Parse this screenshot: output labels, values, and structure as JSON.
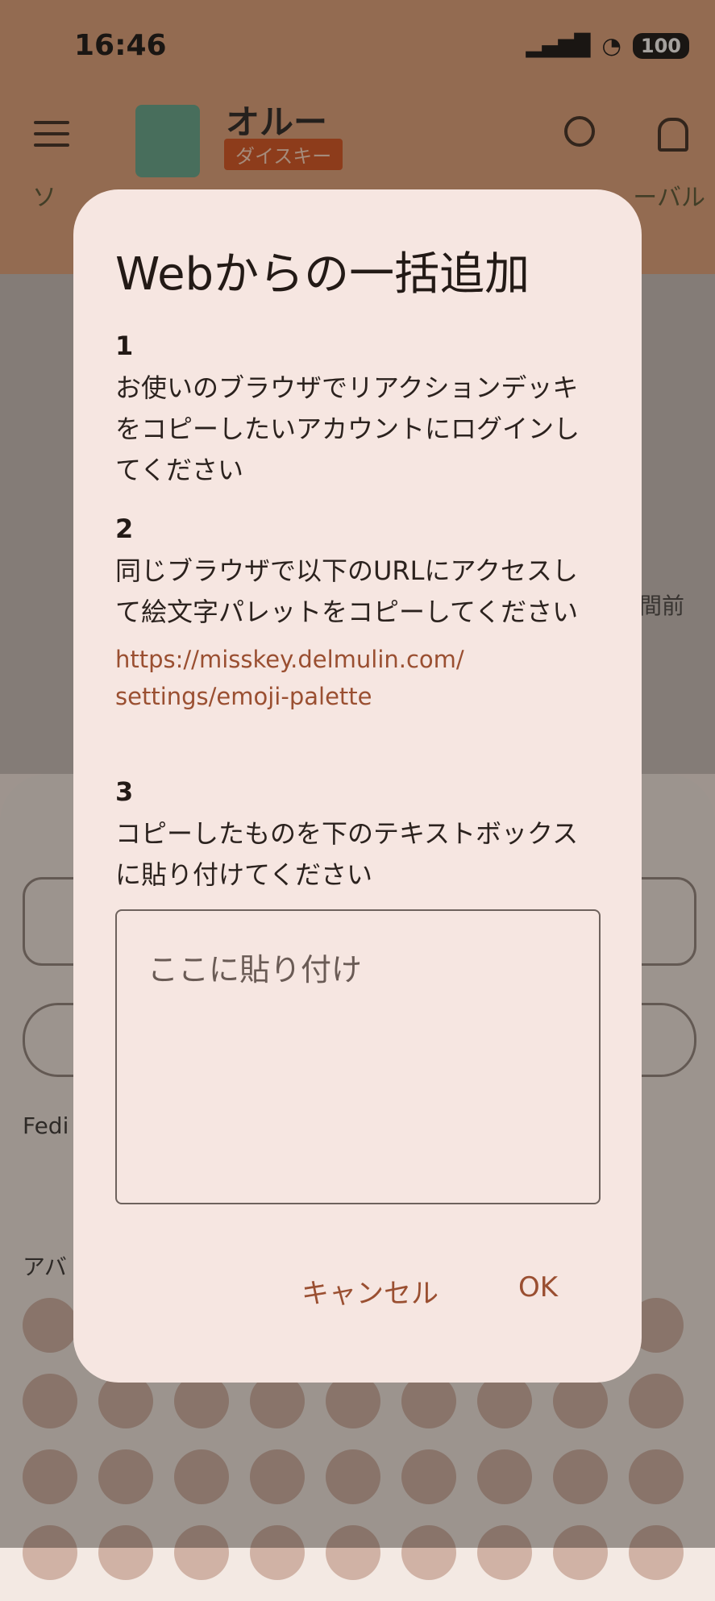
{
  "status_bar": {
    "time": "16:46",
    "battery": "100"
  },
  "header": {
    "title": "オルー",
    "badge": "ダイスキー"
  },
  "tabs": {
    "left_partial": "ソ",
    "right_partial": "ーバル"
  },
  "background": {
    "time_partial": "間前",
    "fedi_label_partial": "Fedi",
    "avatar_label_partial": "アバ"
  },
  "dialog": {
    "title": "Webからの一括追加",
    "steps": [
      {
        "number": "1",
        "text": "お使いのブラウザでリアクションデッキをコピーしたいアカウントにログインしてください"
      },
      {
        "number": "2",
        "text": "同じブラウザで以下のURLにアクセスして絵文字パレットをコピーしてください",
        "link_line1": "https://misskey.delmulin.com/",
        "link_line2": "settings/emoji-palette"
      },
      {
        "number": "3",
        "text": "コピーしたものを下のテキストボックスに貼り付けてください"
      }
    ],
    "textarea_placeholder": "ここに貼り付け",
    "cancel_label": "キャンセル",
    "ok_label": "OK"
  },
  "colors": {
    "accent": "#9a4f31",
    "dialog_bg": "#f6e6e1",
    "header_bg": "#e0a37b"
  }
}
